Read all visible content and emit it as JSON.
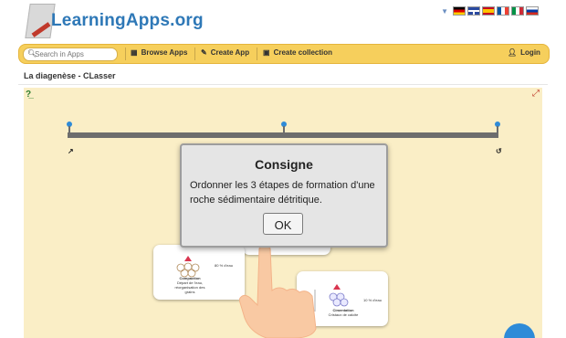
{
  "header": {
    "logo_text": "LearningApps.org",
    "flags": [
      {
        "name": "de-flag-icon",
        "color": "#d4af37"
      },
      {
        "name": "gb-flag-icon",
        "color": "#2a4aa0"
      },
      {
        "name": "es-flag-icon",
        "color": "#d94c2f"
      },
      {
        "name": "fr-flag-icon",
        "color": "#3a5fb5"
      },
      {
        "name": "it-flag-icon",
        "color": "#3a9b3a"
      },
      {
        "name": "ru-flag-icon",
        "color": "#c73b3b"
      }
    ]
  },
  "nav": {
    "search_placeholder": "Search in Apps",
    "browse_label": "Browse Apps",
    "create_label": "Create App",
    "collection_label": "Create collection",
    "login_label": "Login"
  },
  "page": {
    "title": "La diagenèse - CLasser"
  },
  "timeline": {
    "start_label": "↗",
    "end_label": "↺"
  },
  "cards": [
    {
      "caption_main": "Compaction",
      "caption_sub": "Départ de l'eau, réorganisation des grains",
      "side_text": "80 % d'eau"
    },
    {
      "caption_main": "Cimentation",
      "caption_sub": "Cristaux de calcite",
      "side_text": "10 % d'eau"
    }
  ],
  "dialog": {
    "title": "Consigne",
    "body": "Ordonner les 3 étapes de formation d'une roche sédimentaire détritique.",
    "ok_label": "OK"
  },
  "colors": {
    "navbar": "#f6cf5c",
    "canvas": "#faeec6",
    "logo": "#2e78b7",
    "pin": "#2e8bd8"
  }
}
